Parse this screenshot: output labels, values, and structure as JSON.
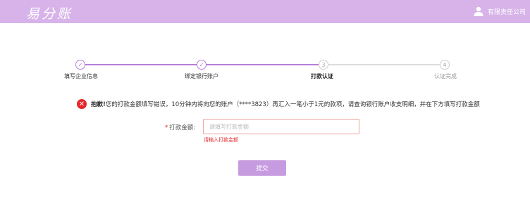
{
  "header": {
    "logo_text": "易分账",
    "account_name": "有限责任公司",
    "bg_color": "#d7b3e9"
  },
  "steps": [
    {
      "index": "1",
      "label": "填写企业信息",
      "status": "done"
    },
    {
      "index": "2",
      "label": "绑定银行账户",
      "status": "done"
    },
    {
      "index": "3",
      "label": "打款认证",
      "status": "current"
    },
    {
      "index": "4",
      "label": "认证完成",
      "status": "todo"
    }
  ],
  "alert": {
    "icon": "error-x-icon",
    "title": "抱歉!",
    "message": "您的打款金额填写错误，10分钟内将向您的账户（****3823）再汇入一笔小于1元的款项，请查询银行账户收支明细，并在下方填写打款金额"
  },
  "form": {
    "required_mark": "*",
    "amount_label": "打款金额:",
    "amount_placeholder": "请填写打款金额",
    "amount_value": "",
    "amount_error": "请输入打款金额"
  },
  "submit_label": "提交",
  "colors": {
    "accent": "#b47fd9",
    "button": "#c79be0",
    "error": "#e6262a"
  }
}
